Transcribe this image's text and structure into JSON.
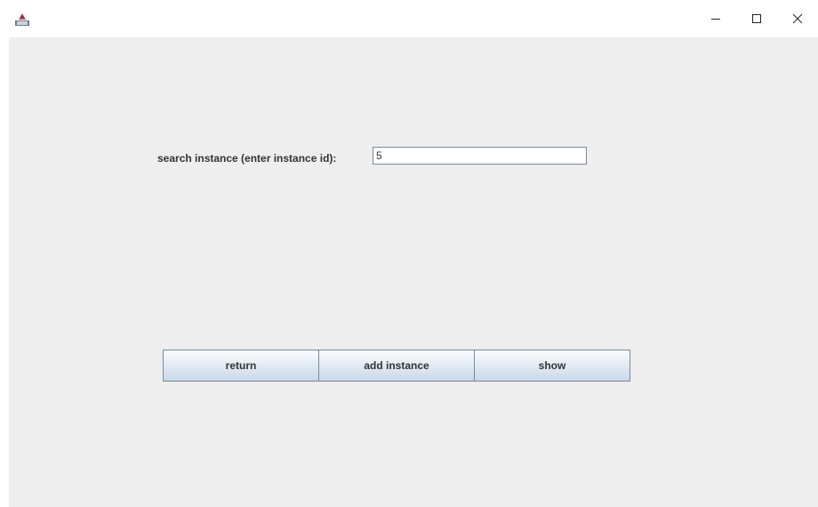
{
  "window": {
    "app_icon": "java-app-icon",
    "controls": {
      "minimize": "minimize-icon",
      "maximize": "maximize-icon",
      "close": "close-icon"
    }
  },
  "search": {
    "label": "search instance (enter instance id):",
    "value": "5"
  },
  "buttons": {
    "return_label": "return",
    "add_label": "add instance",
    "show_label": "show"
  },
  "colors": {
    "background": "#eeeeee",
    "button_border": "#7a8a99",
    "text": "#333333"
  }
}
